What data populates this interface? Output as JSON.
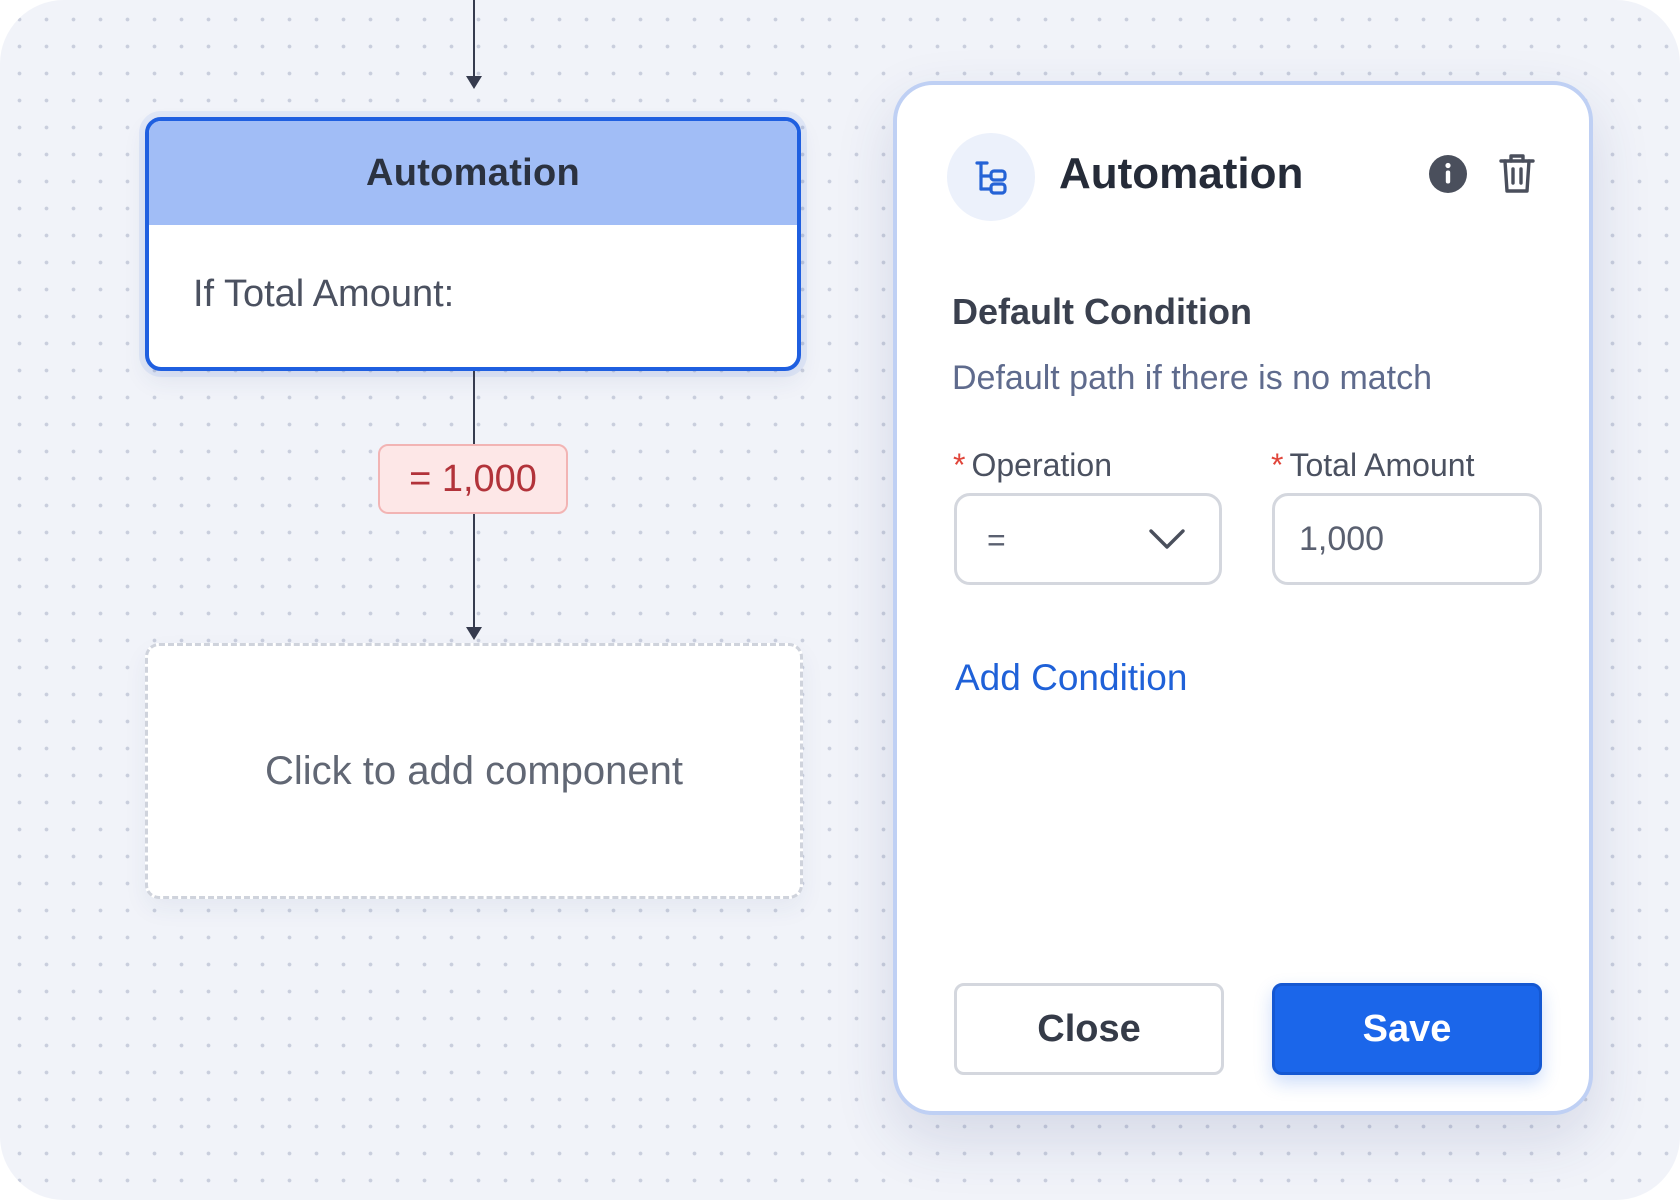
{
  "canvas": {
    "node": {
      "title": "Automation",
      "body": "If Total Amount:"
    },
    "edge_label": "= 1,000",
    "placeholder": "Click to add component"
  },
  "panel": {
    "icon": "flow-tree-icon",
    "title": "Automation",
    "actions": [
      "info-icon",
      "trash-icon"
    ],
    "section_title": "Default Condition",
    "section_desc": "Default path if there is no match",
    "operation": {
      "required_mark": "*",
      "label": "Operation",
      "value": "="
    },
    "total_amount": {
      "required_mark": "*",
      "label": "Total Amount",
      "value": "1,000"
    },
    "add_condition": "Add Condition",
    "buttons": {
      "close": "Close",
      "save": "Save"
    }
  },
  "colors": {
    "accent": "#1f5fe0",
    "node_header": "#a1bdf6",
    "badge_bg": "#fde7e7",
    "badge_text": "#b2333a",
    "save_button": "#1b66ea"
  }
}
